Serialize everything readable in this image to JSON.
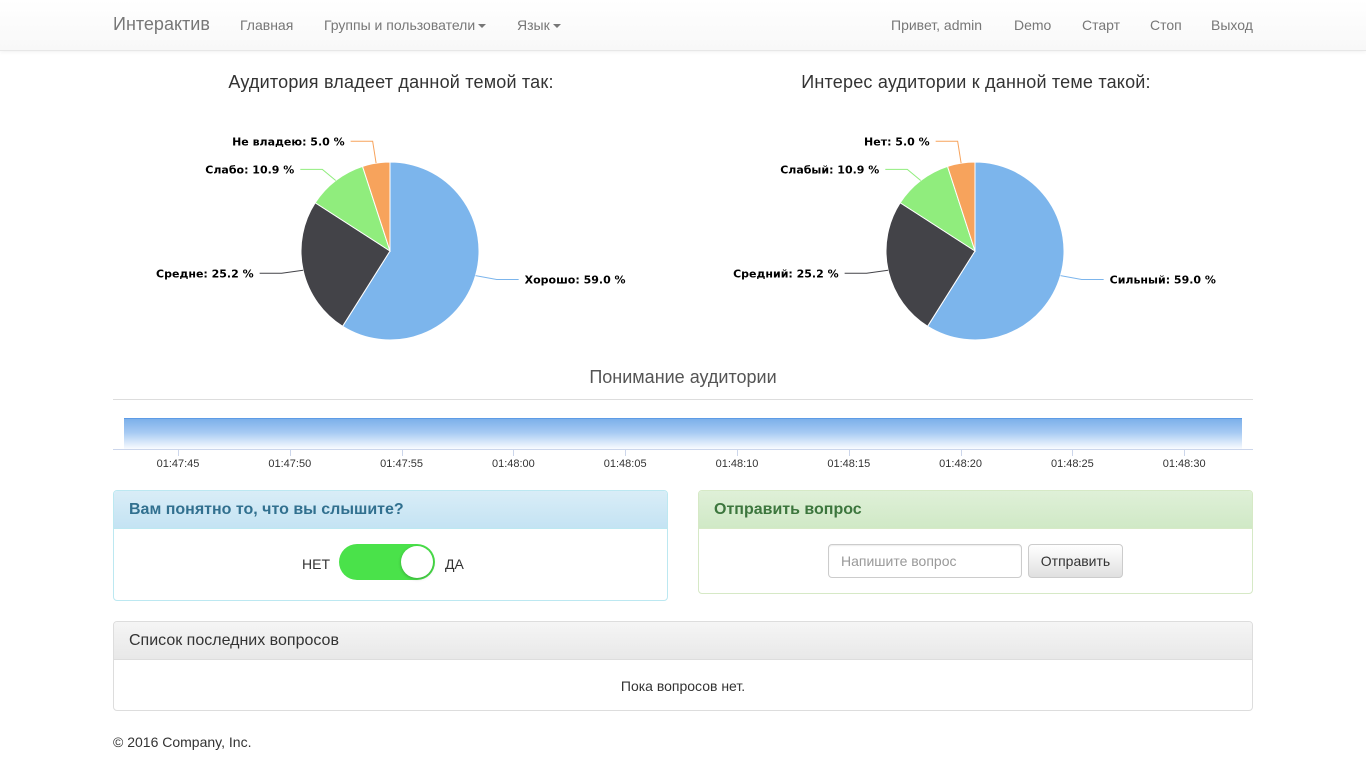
{
  "navbar": {
    "brand": "Интерактив",
    "left_items": [
      {
        "label": "Главная",
        "dropdown": false
      },
      {
        "label": "Группы и пользователи",
        "dropdown": true
      },
      {
        "label": "Язык",
        "dropdown": true
      }
    ],
    "right_items": [
      {
        "label": "Привет, admin"
      },
      {
        "label": "Demo"
      },
      {
        "label": "Старт"
      },
      {
        "label": "Стоп"
      },
      {
        "label": "Выход"
      }
    ]
  },
  "chart_data": [
    {
      "type": "pie",
      "title": "Аудитория владеет данной темой так:",
      "slices": [
        {
          "name": "Хорошо",
          "value": 59.0,
          "color": "#7cb5ec",
          "label": "Хорошо: 59.0 %"
        },
        {
          "name": "Средне",
          "value": 25.2,
          "color": "#434348",
          "label": "Средне: 25.2 %"
        },
        {
          "name": "Слабо",
          "value": 10.9,
          "color": "#90ed7d",
          "label": "Слабо: 10.9 %"
        },
        {
          "name": "Не владею",
          "value": 5.0,
          "color": "#f7a35c",
          "label": "Не владею: 5.0 %"
        }
      ]
    },
    {
      "type": "pie",
      "title": "Интерес аудитории к данной теме такой:",
      "slices": [
        {
          "name": "Сильный",
          "value": 59.0,
          "color": "#7cb5ec",
          "label": "Сильный: 59.0 %"
        },
        {
          "name": "Средний",
          "value": 25.2,
          "color": "#434348",
          "label": "Средний: 25.2 %"
        },
        {
          "name": "Слабый",
          "value": 10.9,
          "color": "#90ed7d",
          "label": "Слабый: 10.9 %"
        },
        {
          "name": "Нет",
          "value": 5.0,
          "color": "#f7a35c",
          "label": "Нет: 5.0 %"
        }
      ]
    },
    {
      "type": "area",
      "title": "Понимание аудитории",
      "x_tick_labels": [
        "01:47:45",
        "01:47:50",
        "01:47:55",
        "01:48:00",
        "01:48:05",
        "01:48:10",
        "01:48:15",
        "01:48:20",
        "01:48:25",
        "01:48:30"
      ],
      "color": "#7cb5ec"
    }
  ],
  "understanding_panel": {
    "heading": "Вам понятно то, что вы слышите?",
    "no_label": "НЕТ",
    "yes_label": "ДА",
    "toggle_on": true
  },
  "question_panel": {
    "heading": "Отправить вопрос",
    "input_placeholder": "Напишите вопрос",
    "input_value": "",
    "send_label": "Отправить"
  },
  "recent_questions": {
    "heading": "Список последних вопросов",
    "empty_text": "Пока вопросов нет."
  },
  "footer": {
    "text": "© 2016 Company, Inc."
  }
}
